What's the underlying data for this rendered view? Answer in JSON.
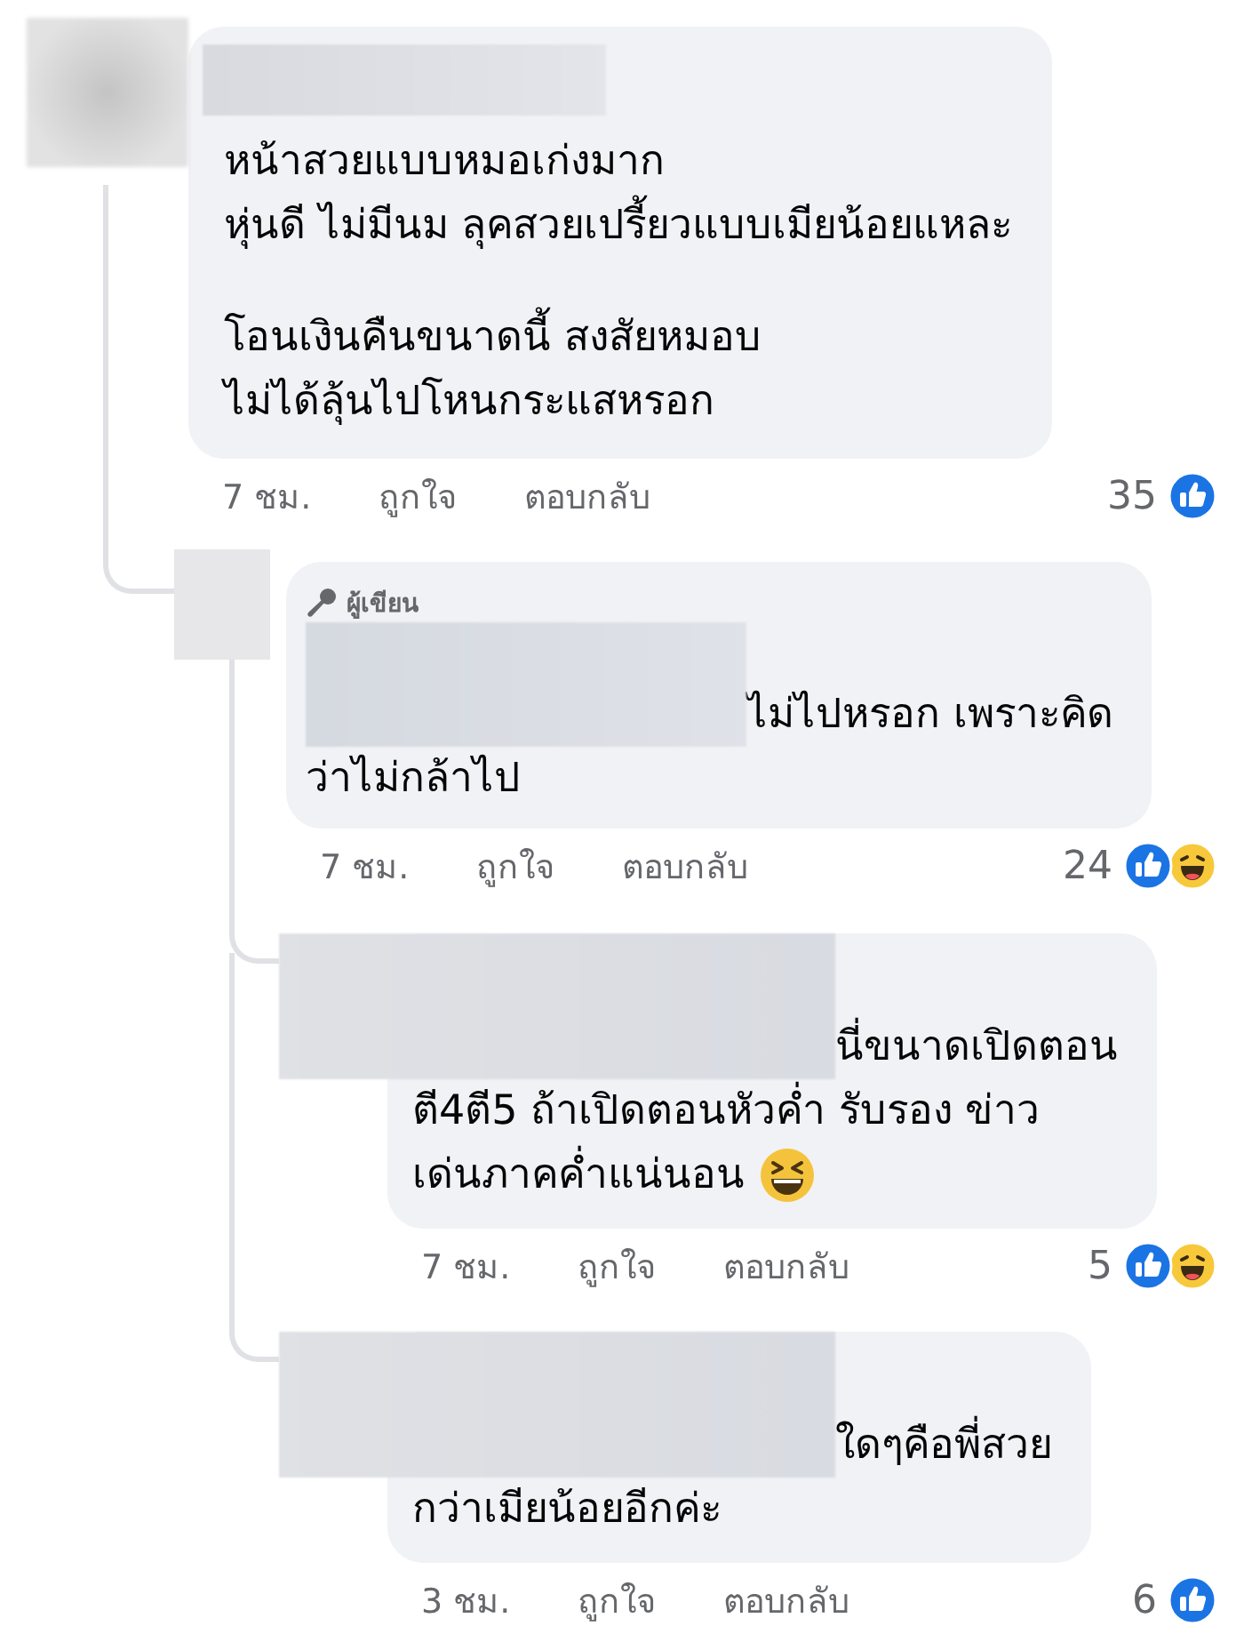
{
  "comments": [
    {
      "kind": "name-bar",
      "paragraphs": [
        [
          "หน้าสวยแบบหมอเก่งมาก",
          "หุ่นดี ไม่มีนม ลุคสวยเปรี้ยวแบบเมียน้อยแหละ"
        ],
        [
          "โอนเงินคืนขนาดนี้ สงสัยหมอบ",
          "ไม่ได้ลุ้นไปโหนกระแสหรอก"
        ]
      ],
      "time": "7 ชม.",
      "like": "ถูกใจ",
      "reply": "ตอบกลับ",
      "reaction_count": "35",
      "reactions": [
        {
          "kind": "like"
        }
      ],
      "children": [
        {
          "kind": "inline",
          "author_badge": "ผู้เขียน",
          "paragraphs": [
            [
              "ไม่ไปหรอก เพราะคิด",
              "ว่าไม่กล้าไป"
            ]
          ],
          "time": "7 ชม.",
          "like": "ถูกใจ",
          "reply": "ตอบกลับ",
          "reaction_count": "24",
          "reactions": [
            {
              "kind": "like"
            },
            {
              "kind": "haha"
            }
          ],
          "children": [
            {
              "kind": "wide",
              "paragraphs": [
                [
                  "นี่ขนาดเปิดตอน",
                  "ตี4ตี5 ถ้าเปิดตอนหัวค่ำ รับรอง ข่าว",
                  "เด่นภาคค่ำแน่นอน"
                ]
              ],
              "end_emoji": {
                "kind": "laughing"
              },
              "time": "7 ชม.",
              "like": "ถูกใจ",
              "reply": "ตอบกลับ",
              "reaction_count": "5",
              "reactions": [
                {
                  "kind": "like"
                },
                {
                  "kind": "haha"
                }
              ]
            },
            {
              "kind": "wide",
              "paragraphs": [
                [
                  "ใดๆคือพี่สวย",
                  "กว่าเมียน้อยอีกค่ะ"
                ]
              ],
              "time": "3 ชม.",
              "like": "ถูกใจ",
              "reply": "ตอบกลับ",
              "reaction_count": "6",
              "reactions": [
                {
                  "kind": "like"
                }
              ]
            }
          ]
        }
      ]
    }
  ]
}
